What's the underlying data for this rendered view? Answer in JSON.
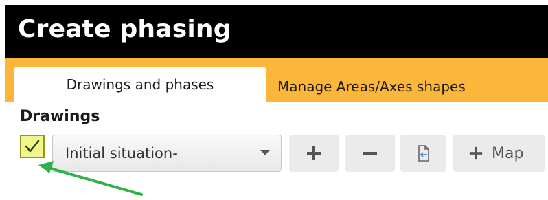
{
  "window": {
    "title": "Create phasing"
  },
  "tabs": [
    {
      "label": "Drawings and phases",
      "active": true
    },
    {
      "label": "Manage Areas/Axes shapes",
      "active": false
    }
  ],
  "drawings": {
    "section_title": "Drawings",
    "checkbox_checked": true,
    "dropdown_value": "Initial situation-",
    "buttons": {
      "add_icon": "plus-icon",
      "remove_icon": "minus-icon",
      "doc_icon": "document-arrow-icon",
      "map_label": "Map"
    }
  },
  "colors": {
    "titlebar_bg": "#000000",
    "tabbar_bg": "#fcb63a",
    "checkbox_highlight": "#f2f58c",
    "annotation_arrow": "#2eb24a"
  }
}
